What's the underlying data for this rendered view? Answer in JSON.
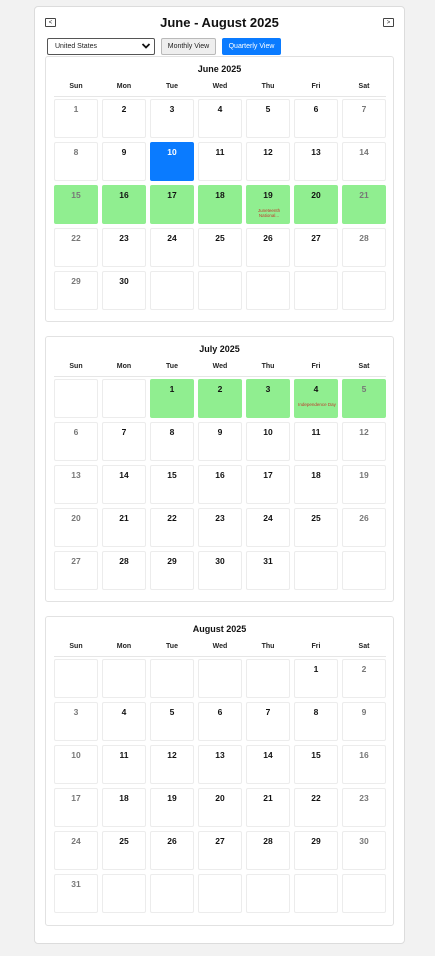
{
  "header": {
    "title": "June - August 2025",
    "prev_label": "<",
    "next_label": ">",
    "country": "United States",
    "monthly_label": "Monthly View",
    "quarterly_label": "Quarterly View"
  },
  "colors": {
    "holiday": "#90ee90",
    "today": "#0a7bff",
    "holiday_text": "#c0392b"
  },
  "weekdays": [
    "Sun",
    "Mon",
    "Tue",
    "Wed",
    "Thu",
    "Fri",
    "Sat"
  ],
  "months": [
    {
      "title": "June 2025",
      "first_weekday": 0,
      "days": 30,
      "rows": 5,
      "today": 10,
      "holiday_days": [
        15,
        16,
        17,
        18,
        19,
        20,
        21
      ],
      "holiday_names": {
        "19": "Juneteenth National..."
      }
    },
    {
      "title": "July 2025",
      "first_weekday": 2,
      "days": 31,
      "rows": 5,
      "today": null,
      "holiday_days": [
        1,
        2,
        3,
        4,
        5
      ],
      "holiday_names": {
        "4": "Independence Day"
      }
    },
    {
      "title": "August 2025",
      "first_weekday": 5,
      "days": 31,
      "rows": 6,
      "today": null,
      "holiday_days": [],
      "holiday_names": {}
    }
  ]
}
